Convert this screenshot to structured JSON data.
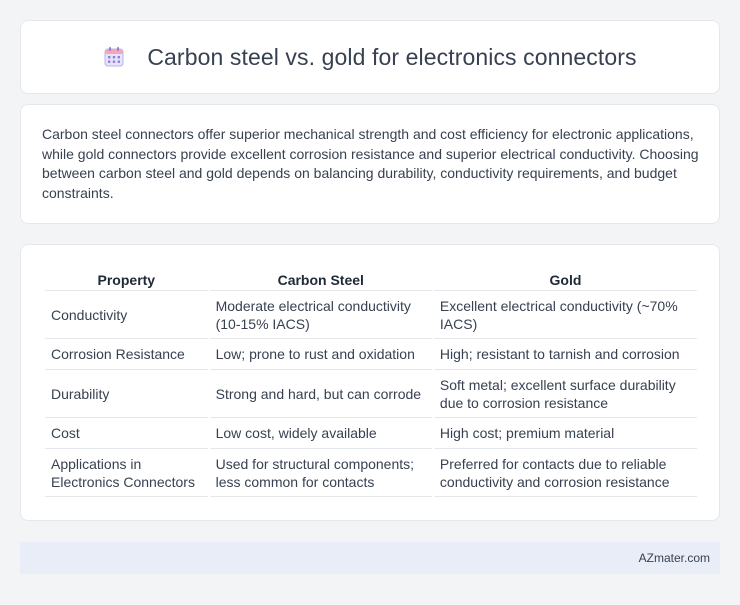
{
  "header": {
    "title": "Carbon steel vs. gold for electronics connectors",
    "icon": "calendar-icon"
  },
  "intro": {
    "text": "Carbon steel connectors offer superior mechanical strength and cost efficiency for electronic applications, while gold connectors provide excellent corrosion resistance and superior electrical conductivity. Choosing between carbon steel and gold depends on balancing durability, conductivity requirements, and budget constraints."
  },
  "table": {
    "headers": [
      "Property",
      "Carbon Steel",
      "Gold"
    ],
    "rows": [
      [
        "Conductivity",
        "Moderate electrical conductivity (10-15% IACS)",
        "Excellent electrical conductivity (~70% IACS)"
      ],
      [
        "Corrosion Resistance",
        "Low; prone to rust and oxidation",
        "High; resistant to tarnish and corrosion"
      ],
      [
        "Durability",
        "Strong and hard, but can corrode",
        "Soft metal; excellent surface durability due to corrosion resistance"
      ],
      [
        "Cost",
        "Low cost, widely available",
        "High cost; premium material"
      ],
      [
        "Applications in Electronics Connectors",
        "Used for structural components; less common for contacts",
        "Preferred for contacts due to reliable conductivity and corrosion resistance"
      ]
    ]
  },
  "footer": {
    "brand": "AZmater.com"
  },
  "colors": {
    "page_bg": "#f3f4f6",
    "card_bg": "#ffffff",
    "footer_bg": "#e8edf7",
    "icon_accent": "#8b7fd6"
  }
}
